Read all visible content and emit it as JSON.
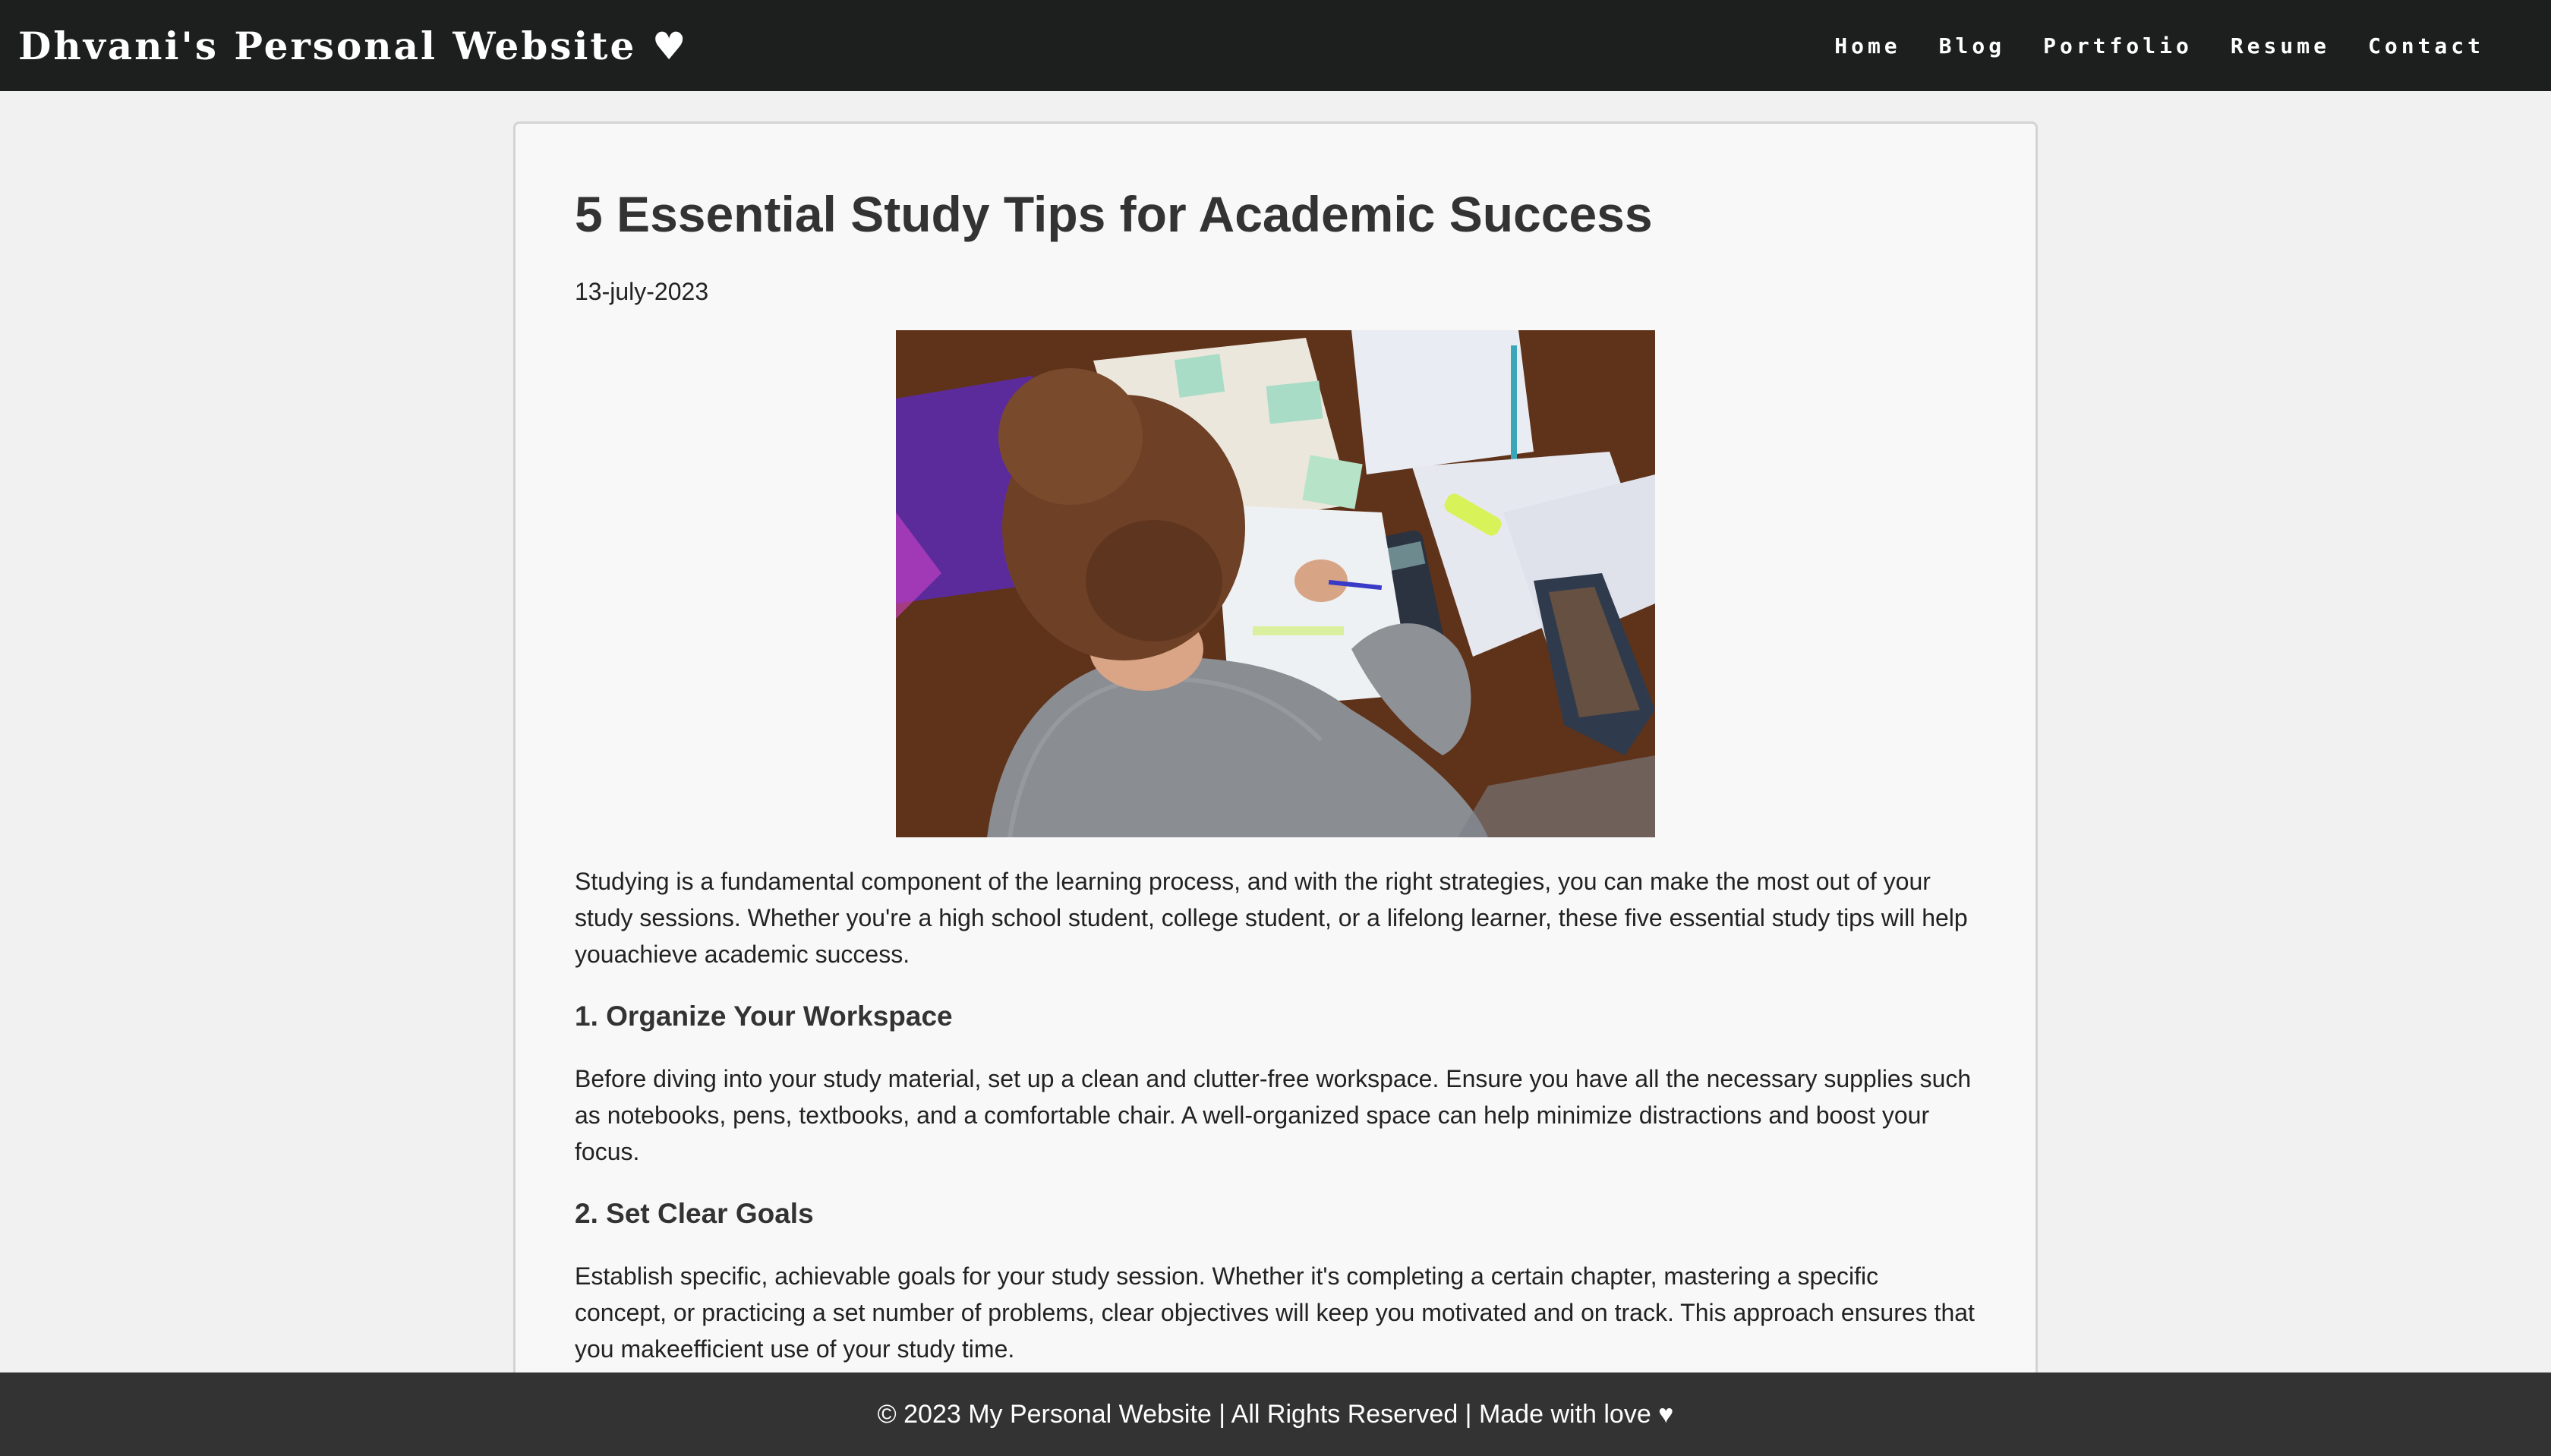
{
  "header": {
    "site_title": "Dhvani's Personal Website ♥",
    "nav": [
      "Home",
      "Blog",
      "Portfolio",
      "Resume",
      "Contact"
    ]
  },
  "post": {
    "title": "5 Essential Study Tips for Academic Success",
    "date": "13-july-2023",
    "intro": "Studying is a fundamental component of the learning process, and with the right strategies, you can make the most out of your study sessions. Whether you're a high school student, college student, or a lifelong learner, these five essential study tips will help youachieve academic success.",
    "sections": [
      {
        "heading": "1. Organize Your Workspace",
        "text": "Before diving into your study material, set up a clean and clutter-free workspace. Ensure you have all the necessary supplies such as notebooks, pens, textbooks, and a comfortable chair. A well-organized space can help minimize distractions and boost your focus."
      },
      {
        "heading": "2. Set Clear Goals",
        "text": "Establish specific, achievable goals for your study session. Whether it's completing a certain chapter, mastering a specific concept, or practicing a set number of problems, clear objectives will keep you motivated and on track. This approach ensures that you makeefficient use of your study time."
      }
    ]
  },
  "footer": {
    "text": "© 2023 My Personal Website | All Rights Reserved | Made with love ♥"
  },
  "colors": {
    "header_bg": "#1d1e1e",
    "footer_bg": "#333333",
    "page_bg": "#f1f1f1",
    "card_bg": "#f8f8f8"
  }
}
